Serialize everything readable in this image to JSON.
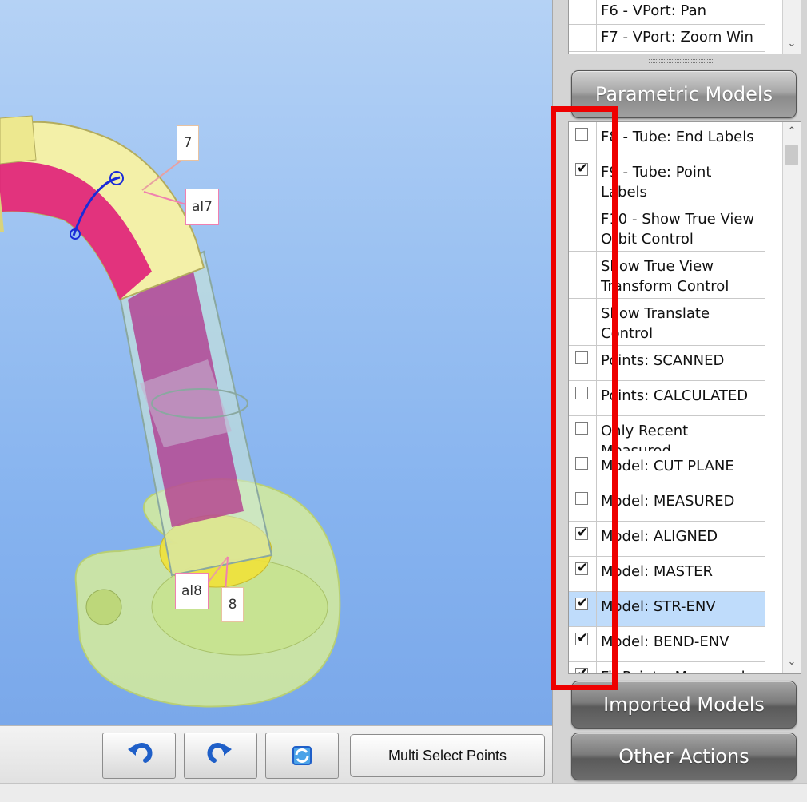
{
  "viewport": {
    "callouts": [
      {
        "name": "callout-7",
        "text": "7"
      },
      {
        "name": "callout-al7",
        "text": "al7"
      },
      {
        "name": "callout-al8",
        "text": "al8"
      },
      {
        "name": "callout-8",
        "text": "8"
      }
    ]
  },
  "toolbar": {
    "undo_icon": "undo-arrow-icon",
    "redo_icon": "redo-arrow-icon",
    "refresh_icon": "refresh-icon",
    "multi_select_label": "Multi Select Points"
  },
  "viewport_list": {
    "items": [
      {
        "label": "F6 - VPort: Pan"
      },
      {
        "label": "F7 - VPort: Zoom Win"
      }
    ]
  },
  "sections": {
    "parametric": "Parametric Models",
    "imported": "Imported Models",
    "other": "Other Actions"
  },
  "model_list": {
    "items": [
      {
        "label": "F8 - Tube: End Labels",
        "checkbox": true,
        "checked": false,
        "selected": false
      },
      {
        "label": "F9 - Tube: Point Labels",
        "checkbox": true,
        "checked": true,
        "selected": false
      },
      {
        "label": "F10 - Show True View Orbit Control",
        "checkbox": false,
        "checked": false,
        "selected": false
      },
      {
        "label": "Show True View Transform Control",
        "checkbox": false,
        "checked": false,
        "selected": false
      },
      {
        "label": "Show Translate Control",
        "checkbox": false,
        "checked": false,
        "selected": false
      },
      {
        "label": "Points: SCANNED",
        "checkbox": true,
        "checked": false,
        "selected": false
      },
      {
        "label": "Points: CALCULATED",
        "checkbox": true,
        "checked": false,
        "selected": false
      },
      {
        "label": "Only Recent Measured",
        "checkbox": true,
        "checked": false,
        "selected": false
      },
      {
        "label": "Model: CUT PLANE",
        "checkbox": true,
        "checked": false,
        "selected": false
      },
      {
        "label": "Model: MEASURED",
        "checkbox": true,
        "checked": false,
        "selected": false
      },
      {
        "label": "Model: ALIGNED",
        "checkbox": true,
        "checked": true,
        "selected": false
      },
      {
        "label": "Model: MASTER",
        "checkbox": true,
        "checked": true,
        "selected": false
      },
      {
        "label": "Model: STR-ENV",
        "checkbox": true,
        "checked": true,
        "selected": true
      },
      {
        "label": "Model: BEND-ENV",
        "checkbox": true,
        "checked": true,
        "selected": false
      },
      {
        "label": "Fit Points: Measured",
        "checkbox": true,
        "checked": true,
        "selected": false
      }
    ]
  },
  "colors": {
    "highlight": "#ee0000",
    "selected_row": "#bfdcfb",
    "tube_yellow": "#f3f0a8",
    "tube_magenta": "#e0287a"
  }
}
